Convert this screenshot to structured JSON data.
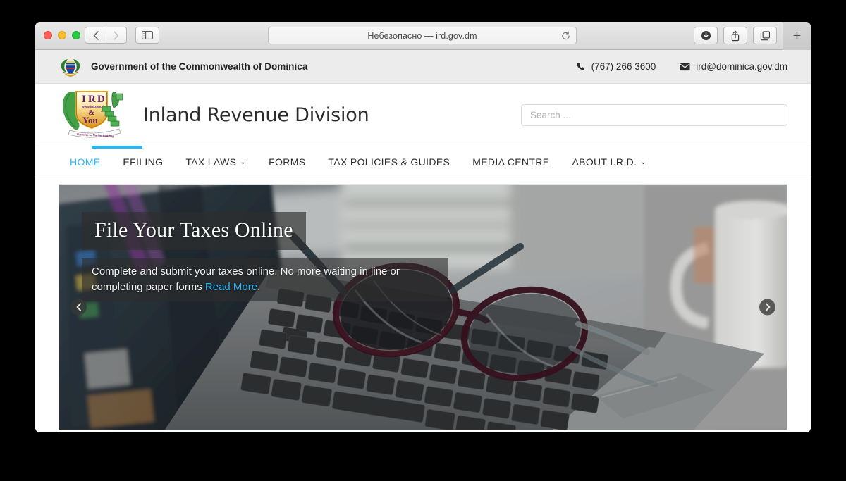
{
  "browser": {
    "address_text": "Небезопасно — ird.gov.dm",
    "back_label": "‹",
    "forward_label": "›",
    "new_tab_label": "+",
    "icons": {
      "sidebar": "sidebar-icon",
      "reload": "reload-icon",
      "download": "download-icon",
      "share": "share-icon",
      "tab-overview": "tab-overview-icon"
    }
  },
  "gov_bar": {
    "title": "Government of the Commonwealth of Dominica",
    "phone": "(767) 266 3600",
    "email": "ird@dominica.gov.dm"
  },
  "brand": {
    "site_title": "Inland Revenue Division",
    "logo_lines": {
      "acronym": [
        "I",
        "R",
        "D"
      ],
      "url": "www.ird.gov.dm",
      "amp": "&",
      "you": "You",
      "ribbon": "Partners In Nation Building"
    }
  },
  "search": {
    "placeholder": "Search ...",
    "value": ""
  },
  "nav": {
    "items": [
      {
        "label": "HOME",
        "active": true,
        "has_caret": false
      },
      {
        "label": "EFILING",
        "active": false,
        "has_caret": false
      },
      {
        "label": "TAX LAWS",
        "active": false,
        "has_caret": true
      },
      {
        "label": "FORMS",
        "active": false,
        "has_caret": false
      },
      {
        "label": "TAX POLICIES & GUIDES",
        "active": false,
        "has_caret": false
      },
      {
        "label": "MEDIA CENTRE",
        "active": false,
        "has_caret": false
      },
      {
        "label": "ABOUT I.R.D.",
        "active": false,
        "has_caret": true
      }
    ],
    "caret_glyph": "⌄"
  },
  "hero": {
    "title": "File Your Taxes Online",
    "body_part1": "Complete and submit your taxes online. No more waiting in line or completing paper forms ",
    "read_more": "Read More",
    "body_part2": ".",
    "prev_glyph": "❮",
    "next_glyph": "❯",
    "image_description": "Eyeglasses resting on an open laptop keyboard with stacked papers and a white mug"
  },
  "colors": {
    "accent": "#29b6f6",
    "gov_bar_bg": "#ececec",
    "text": "#2d2d2d",
    "link": "#29b6f6"
  }
}
